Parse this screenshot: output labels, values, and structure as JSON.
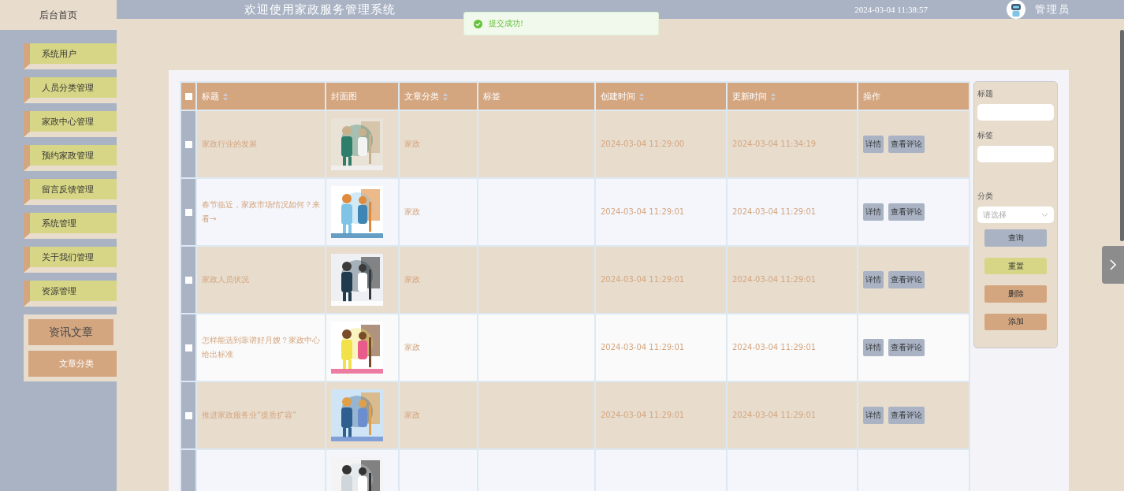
{
  "sidebar": {
    "home": "后台首页",
    "items": [
      {
        "label": "系统用户"
      },
      {
        "label": "人员分类管理"
      },
      {
        "label": "家政中心管理"
      },
      {
        "label": "预约家政管理"
      },
      {
        "label": "留言反馈管理"
      },
      {
        "label": "系统管理"
      },
      {
        "label": "关于我们管理"
      },
      {
        "label": "资源管理"
      }
    ],
    "submenu": {
      "title": "资讯文章",
      "items": [
        {
          "label": "文章分类"
        }
      ]
    }
  },
  "header": {
    "title": "欢迎使用家政服务管理系统",
    "time": "2024-03-04 11:38:57",
    "user": "管理员"
  },
  "toast": {
    "message": "提交成功!"
  },
  "table": {
    "select_all": {
      "checked": false
    },
    "columns": [
      {
        "label": "标题",
        "sortable": true
      },
      {
        "label": "封面图",
        "sortable": false
      },
      {
        "label": "文章分类",
        "sortable": true
      },
      {
        "label": "标签",
        "sortable": false
      },
      {
        "label": "创建时间",
        "sortable": true
      },
      {
        "label": "更新时间",
        "sortable": true
      },
      {
        "label": "操作",
        "sortable": false
      }
    ],
    "rows": [
      {
        "checked": false,
        "title": "家政行业的发展",
        "cover": {
          "kind": "picture"
        },
        "category": "家政",
        "created": "2024-03-04 11:29:00",
        "updated": "2024-03-04 11:34:19",
        "actions": [
          "详情",
          "查看评论"
        ]
      },
      {
        "checked": false,
        "title": "春节临近，家政市场情况如何？来看→",
        "cover": {
          "kind": "picture"
        },
        "category": "家政",
        "created": "2024-03-04 11:29:01",
        "updated": "2024-03-04 11:29:01",
        "actions": [
          "详情",
          "查看评论"
        ]
      },
      {
        "checked": false,
        "title": "家政人员状况",
        "cover": {
          "kind": "picture"
        },
        "category": "家政",
        "created": "2024-03-04 11:29:01",
        "updated": "2024-03-04 11:29:01",
        "actions": [
          "详情",
          "查看评论"
        ]
      },
      {
        "checked": false,
        "title": "怎样能选到靠谱好月嫂？家政中心给出标准",
        "cover": {
          "kind": "picture"
        },
        "category": "家政",
        "created": "2024-03-04 11:29:01",
        "updated": "2024-03-04 11:29:01",
        "actions": [
          "详情",
          "查看评论"
        ]
      },
      {
        "checked": false,
        "title": "推进家政服务业“提质扩容”",
        "cover": {
          "kind": "picture"
        },
        "category": "家政",
        "created": "2024-03-04 11:29:01",
        "updated": "2024-03-04 11:29:01",
        "actions": [
          "详情",
          "查看评论"
        ]
      },
      {
        "cover": {
          "kind": "picture"
        }
      }
    ]
  },
  "search": {
    "fields": [
      {
        "label": "标题",
        "kind": "input"
      },
      {
        "label": "标签",
        "kind": "input"
      },
      {
        "label": "分类",
        "kind": "select",
        "placeholder": "请选择"
      }
    ],
    "buttons": [
      {
        "label": "查询",
        "kind": "query"
      },
      {
        "label": "重置",
        "kind": "reset"
      },
      {
        "label": "删除",
        "kind": "delete"
      },
      {
        "label": "添加",
        "kind": "add"
      }
    ]
  }
}
